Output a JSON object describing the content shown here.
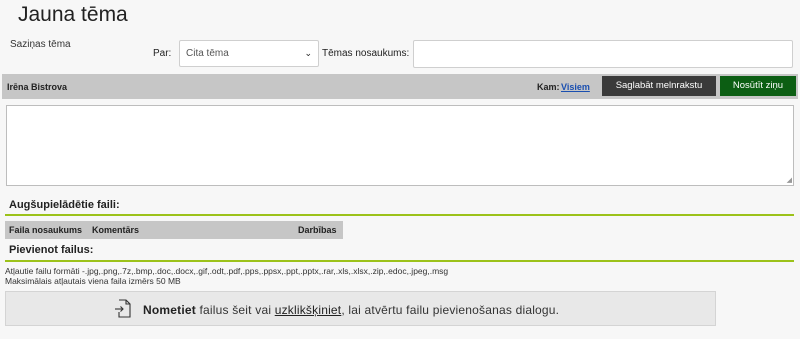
{
  "page": {
    "title": "Jauna tēma"
  },
  "subject_section": {
    "label": "Saziņas tēma"
  },
  "topic": {
    "par_label": "Par:",
    "selected_option": "Cita tēma",
    "name_label": "Tēmas nosaukums:",
    "name_value": ""
  },
  "compose": {
    "sender": "Irēna Bistrova",
    "to_label": "Kam:",
    "to_value": "Visiem",
    "save_draft_label": "Saglabāt melnrakstu",
    "send_label": "Nosūtīt ziņu",
    "message_value": ""
  },
  "uploaded": {
    "heading": "Augšupielādētie faili:",
    "columns": [
      "Faila nosaukums",
      "Komentārs",
      "Darbības"
    ]
  },
  "add_files": {
    "heading": "Pievienot failus:",
    "allowed_formats": "Atļautie failu formāti -.jpg,.png,.7z,.bmp,.doc,.docx,.gif,.odt,.pdf,.pps,.ppsx,.ppt,.pptx,.rar,.xls,.xlsx,.zip,.edoc,.jpeg,.msg",
    "max_size": "Maksimālais atļautais viena faila izmērs 50 MB",
    "dropzone_bold": "Nometiet",
    "dropzone_middle": " failus šeit vai ",
    "dropzone_link": "uzklikšķiniet",
    "dropzone_end": ", lai atvērtu failu pievienošanas dialogu."
  },
  "colors": {
    "send_button_bg": "#0c5e13",
    "save_draft_bg": "#3a3a3a",
    "toolbar_bg": "#c6c6c6",
    "accent_rule": "#9cc21a",
    "link": "#1a4fb0"
  },
  "icons": [
    "chevron-down-icon",
    "file-upload-icon",
    "resize-grip-icon"
  ]
}
